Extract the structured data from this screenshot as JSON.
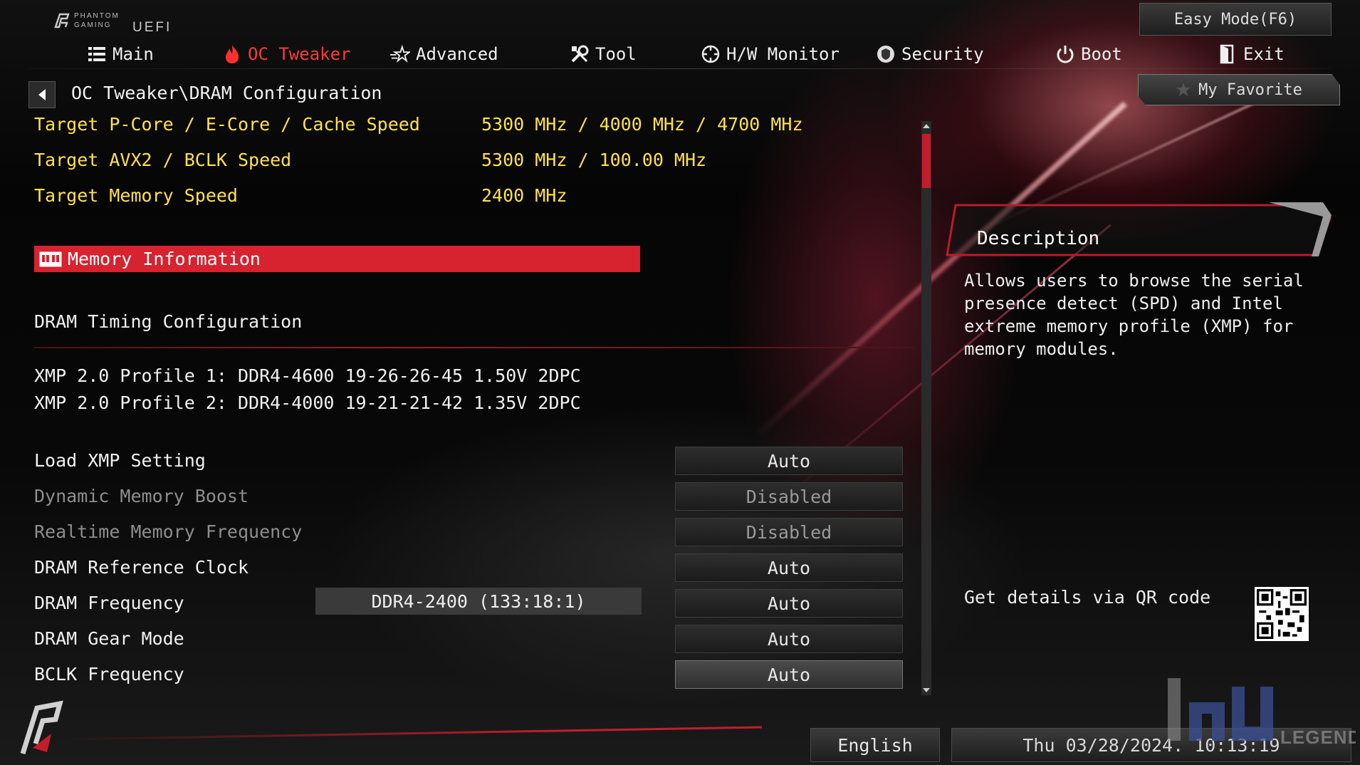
{
  "brand": {
    "line1": "PHANTOM",
    "line2": "GAMING",
    "uefi": "UEFI"
  },
  "easy_mode_label": "Easy Mode(F6)",
  "tabs": [
    {
      "label": "Main",
      "icon": "list-icon"
    },
    {
      "label": "OC Tweaker",
      "icon": "flame-icon",
      "active": true
    },
    {
      "label": "Advanced",
      "icon": "star-icon"
    },
    {
      "label": "Tool",
      "icon": "tools-icon"
    },
    {
      "label": "H/W Monitor",
      "icon": "crosshair-icon"
    },
    {
      "label": "Security",
      "icon": "shield-icon"
    },
    {
      "label": "Boot",
      "icon": "power-icon"
    },
    {
      "label": "Exit",
      "icon": "exit-door-icon"
    }
  ],
  "breadcrumb": "OC Tweaker\\DRAM Configuration",
  "my_favorite": "My Favorite",
  "targets": [
    {
      "label": "Target P-Core / E-Core / Cache Speed",
      "value": "5300 MHz / 4000 MHz / 4700 MHz"
    },
    {
      "label": "Target AVX2 / BCLK Speed",
      "value": "5300 MHz / 100.00 MHz"
    },
    {
      "label": "Target Memory Speed",
      "value": "2400 MHz"
    }
  ],
  "memory_information": "Memory Information",
  "dram_timing": "DRAM Timing Configuration",
  "xmp_profiles": [
    "XMP 2.0 Profile 1: DDR4-4600 19-26-26-45 1.50V 2DPC",
    "XMP 2.0 Profile 2: DDR4-4000 19-21-21-42 1.35V 2DPC"
  ],
  "settings": [
    {
      "label": "Load XMP Setting",
      "value": "Auto"
    },
    {
      "label": "Dynamic Memory Boost",
      "value": "Disabled",
      "disabled": true
    },
    {
      "label": "Realtime Memory Frequency",
      "value": "Disabled",
      "disabled": true
    },
    {
      "label": "DRAM Reference Clock",
      "value": "Auto"
    },
    {
      "label": "DRAM Frequency",
      "value": "Auto",
      "info": "DDR4-2400 (133:18:1)"
    },
    {
      "label": "DRAM Gear Mode",
      "value": "Auto"
    },
    {
      "label": "BCLK Frequency",
      "value": "Auto",
      "highlighted": true
    }
  ],
  "description": {
    "title": "Description",
    "body": "Allows users to browse the serial\npresence detect (SPD) and Intel\nextreme memory profile (XMP) for\nmemory modules.",
    "qr_text": "Get details via QR code"
  },
  "footer": {
    "language": "English",
    "datetime": "Thu 03/28/2024. 10:13:19"
  },
  "watermark": "LEGEND",
  "colors": {
    "accent": "#d6232f",
    "target_text": "#ffe24a",
    "active_tab": "#ff3a3a"
  }
}
